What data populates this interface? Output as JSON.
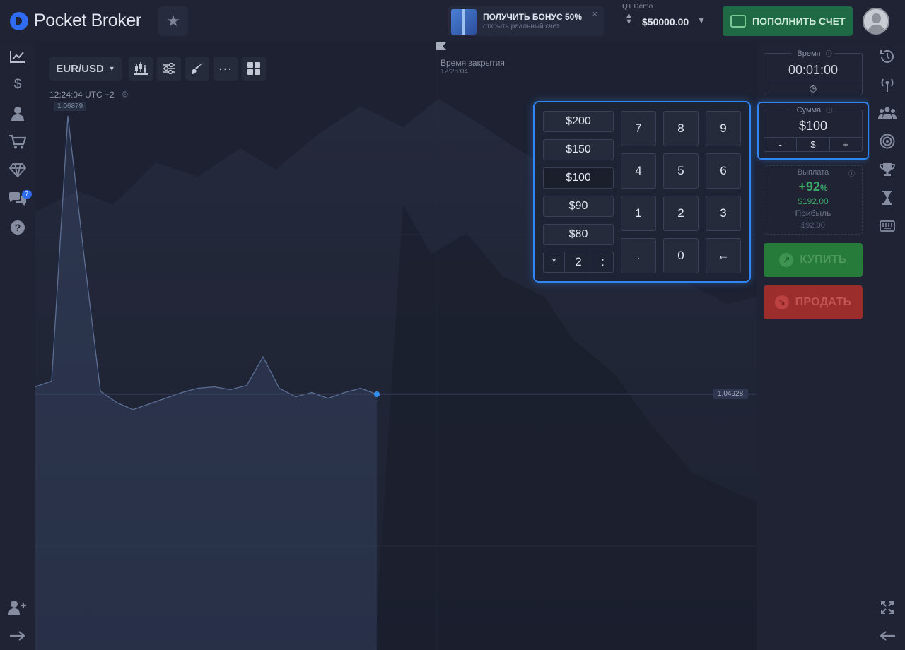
{
  "header": {
    "logo_text": "Pocket Broker",
    "bonus": {
      "title": "ПОЛУЧИТЬ БОНУС 50%",
      "subtitle": "открыть реальный счет",
      "close": "×"
    },
    "account": {
      "label": "QT Demo",
      "balance": "$50000.00"
    },
    "deposit_label": "ПОПОЛНИТЬ СЧЕТ"
  },
  "sidebar_left": {
    "chat_badge": "7"
  },
  "chart": {
    "asset": "EUR/USD",
    "clock": "12:24:04 UTC +2",
    "price_high": "1.06879",
    "price_current": "1.04928",
    "close_label": "Время закрытия",
    "close_time": "12:25:04"
  },
  "chart_data": {
    "type": "area",
    "series": [
      {
        "values": [
          1.0498,
          1.0502,
          1.06879,
          1.0589,
          1.0495,
          1.0487,
          1.0482,
          1.0486,
          1.049,
          1.0494,
          1.0497,
          1.0498,
          1.0496,
          1.0499,
          1.0519,
          1.0497,
          1.0491,
          1.0494,
          1.049,
          1.0494,
          1.0497,
          1.04928
        ]
      }
    ],
    "current": 1.04928,
    "high": 1.06879
  },
  "keypad": {
    "presets": [
      "$200",
      "$150",
      "$100",
      "$90",
      "$80"
    ],
    "active_preset": 2,
    "multiplier": {
      "mul": "*",
      "value": "2",
      "div": ":"
    },
    "keys": [
      "7",
      "8",
      "9",
      "4",
      "5",
      "6",
      "1",
      "2",
      "3",
      ".",
      "0",
      "←"
    ]
  },
  "trade": {
    "time_label": "Время",
    "time_value": "00:01:00",
    "amount_label": "Сумма",
    "amount_value": "$100",
    "amount_minus": "-",
    "amount_currency": "$",
    "amount_plus": "+",
    "payout_label": "Выплата",
    "payout_percent": "+92",
    "payout_percent_sign": "%",
    "payout_amount": "$192.00",
    "profit_label": "Прибыль",
    "profit_amount": "$92.00",
    "buy_label": "КУПИТЬ",
    "sell_label": "ПРОДАТЬ"
  },
  "colors": {
    "accent": "#2f86f0",
    "buy": "#267a3a",
    "sell": "#9b2d2d",
    "deposit": "#1f6a44",
    "payout": "#3aa667"
  }
}
